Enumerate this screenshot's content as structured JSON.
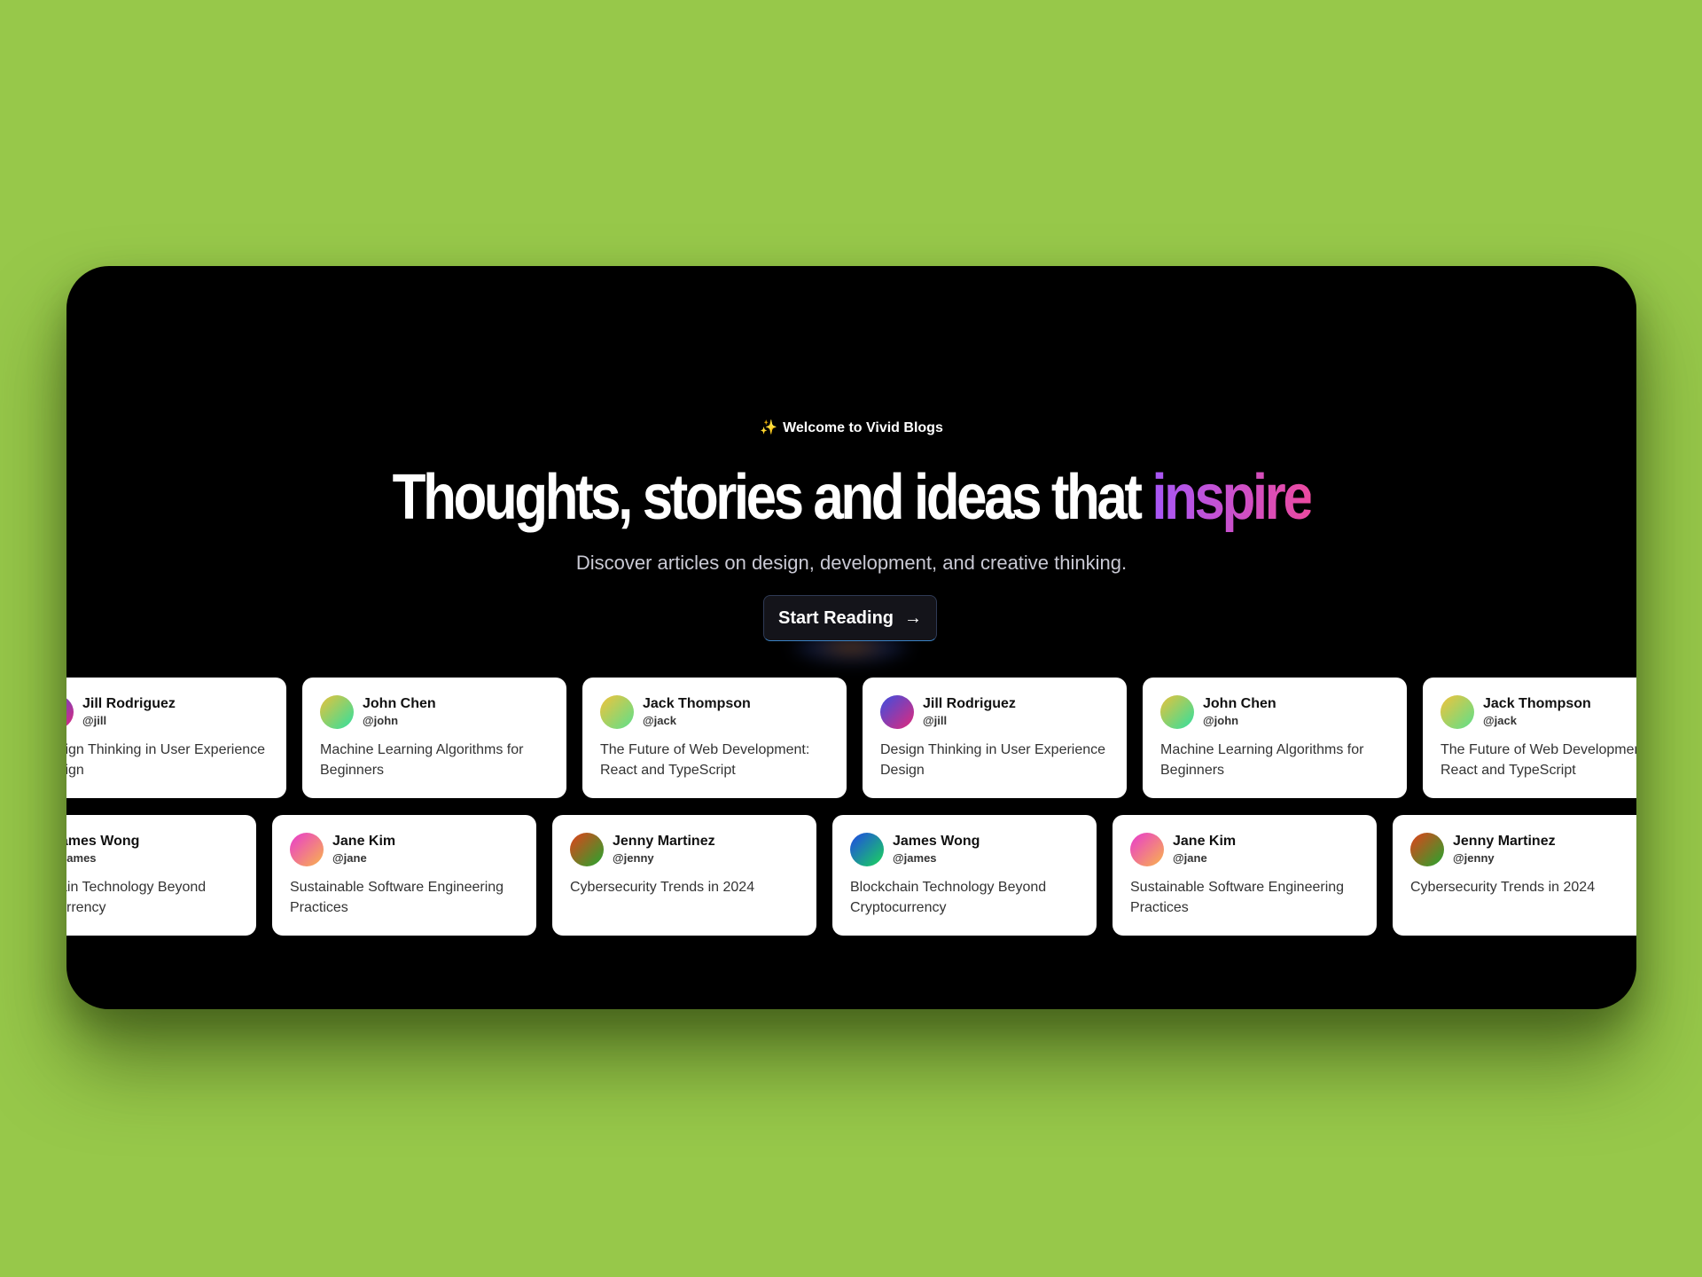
{
  "hero": {
    "welcome_icon": "✨",
    "welcome_text": "Welcome to Vivid Blogs",
    "headline_main": "Thoughts, stories and ideas that ",
    "headline_accent": "inspire",
    "subtitle": "Discover articles on design, development, and creative thinking.",
    "cta_label": "Start Reading",
    "cta_icon": "→"
  },
  "colors": {
    "page_background": "#97c84a",
    "frame_background": "#000000",
    "accent_gradient_start": "#a757f7",
    "accent_gradient_end": "#ec4aa0"
  },
  "rows": [
    {
      "cards": [
        {
          "name": "Jill Rodriguez",
          "handle": "@jill",
          "title": "Design Thinking in User Experience Design",
          "avatar": "g-jill"
        },
        {
          "name": "John Chen",
          "handle": "@john",
          "title": "Machine Learning Algorithms for Beginners",
          "avatar": "g-john"
        },
        {
          "name": "Jack Thompson",
          "handle": "@jack",
          "title": "The Future of Web Development: React and TypeScript",
          "avatar": "g-jack"
        },
        {
          "name": "Jill Rodriguez",
          "handle": "@jill",
          "title": "Design Thinking in User Experience Design",
          "avatar": "g-jill"
        },
        {
          "name": "John Chen",
          "handle": "@john",
          "title": "Machine Learning Algorithms for Beginners",
          "avatar": "g-john"
        },
        {
          "name": "Jack Thompson",
          "handle": "@jack",
          "title": "The Future of Web Development: React and TypeScript",
          "avatar": "g-jack"
        }
      ]
    },
    {
      "cards": [
        {
          "name": "James Wong",
          "handle": "@james",
          "title": "Blockchain Technology Beyond Cryptocurrency",
          "avatar": "g-james"
        },
        {
          "name": "Jane Kim",
          "handle": "@jane",
          "title": "Sustainable Software Engineering Practices",
          "avatar": "g-jane"
        },
        {
          "name": "Jenny Martinez",
          "handle": "@jenny",
          "title": "Cybersecurity Trends in 2024",
          "avatar": "g-jenny"
        },
        {
          "name": "James Wong",
          "handle": "@james",
          "title": "Blockchain Technology Beyond Cryptocurrency",
          "avatar": "g-james"
        },
        {
          "name": "Jane Kim",
          "handle": "@jane",
          "title": "Sustainable Software Engineering Practices",
          "avatar": "g-jane"
        },
        {
          "name": "Jenny Martinez",
          "handle": "@jenny",
          "title": "Cybersecurity Trends in 2024",
          "avatar": "g-jenny"
        }
      ]
    }
  ]
}
